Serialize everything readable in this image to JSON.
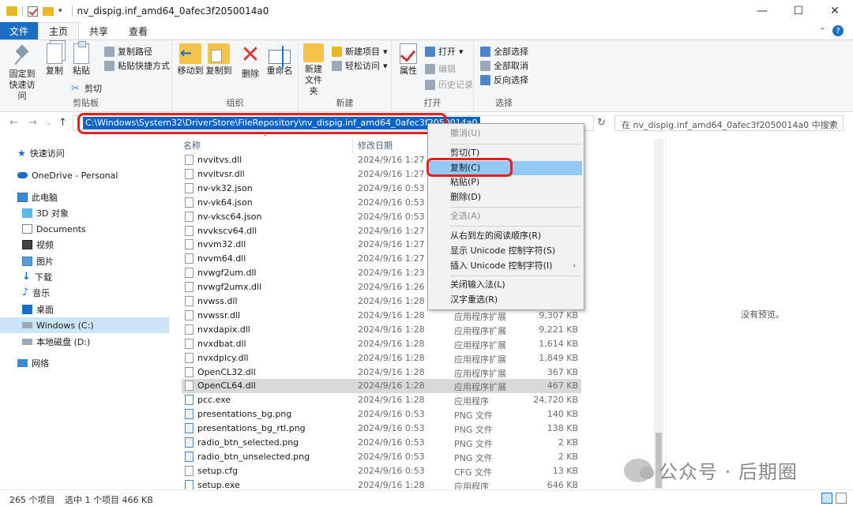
{
  "window": {
    "title": "nv_dispig.inf_amd64_0afec3f2050014a0",
    "minimize": "—",
    "maximize": "☐",
    "close": "✕"
  },
  "ribbon_tabs": [
    "文件",
    "主页",
    "共享",
    "查看"
  ],
  "ribbon": {
    "clipboard": {
      "label": "剪贴板",
      "pin": "固定到快速访问",
      "copy": "复制",
      "paste": "粘贴",
      "copy_path": "复制路径",
      "paste_shortcut": "粘贴快捷方式",
      "cut": "剪切"
    },
    "organize": {
      "label": "组织",
      "move_to": "移动到",
      "copy_to": "复制到",
      "delete": "删除",
      "rename": "重命名"
    },
    "new": {
      "label": "新建",
      "new_folder": "新建文件夹",
      "new_item": "新建项目",
      "easy_access": "轻松访问"
    },
    "open": {
      "label": "打开",
      "properties": "属性",
      "open": "打开",
      "edit": "编辑",
      "history": "历史记录"
    },
    "select": {
      "label": "选择",
      "select_all": "全部选择",
      "select_none": "全部取消",
      "invert": "反向选择"
    }
  },
  "address": {
    "path": "C:\\Windows\\System32\\DriverStore\\FileRepository\\nv_dispig.inf_amd64_0afec3f2050014a0",
    "search_placeholder": "在 nv_dispig.inf_amd64_0afec3f2050014a0 中搜索"
  },
  "sidebar": [
    {
      "label": "快速访问",
      "icon": "star-icon"
    },
    {
      "label": "OneDrive - Personal",
      "icon": "cloud-icon"
    },
    {
      "label": "此电脑",
      "icon": "computer-icon"
    },
    {
      "label": "3D 对象",
      "icon": "3d-objects-icon"
    },
    {
      "label": "Documents",
      "icon": "documents-icon"
    },
    {
      "label": "视频",
      "icon": "video-icon"
    },
    {
      "label": "图片",
      "icon": "pictures-icon"
    },
    {
      "label": "下载",
      "icon": "download-icon"
    },
    {
      "label": "音乐",
      "icon": "music-icon"
    },
    {
      "label": "桌面",
      "icon": "desktop-icon"
    },
    {
      "label": "Windows (C:)",
      "icon": "drive-icon",
      "selected": true
    },
    {
      "label": "本地磁盘 (D:)",
      "icon": "drive-icon"
    },
    {
      "label": "网络",
      "icon": "network-icon"
    }
  ],
  "columns": {
    "name": "名称",
    "date": "修改日期"
  },
  "files": [
    {
      "name": "nvvitvs.dll",
      "date": "2024/9/16 1:27",
      "type": "",
      "size": ""
    },
    {
      "name": "nvvitvsr.dll",
      "date": "2024/9/16 1:27",
      "type": "",
      "size": ""
    },
    {
      "name": "nv-vk32.json",
      "date": "2024/9/16 0:53",
      "type": "",
      "size": ""
    },
    {
      "name": "nv-vk64.json",
      "date": "2024/9/16 0:53",
      "type": "",
      "size": ""
    },
    {
      "name": "nv-vksc64.json",
      "date": "2024/9/16 0:53",
      "type": "",
      "size": ""
    },
    {
      "name": "nvvkscv64.dll",
      "date": "2024/9/16 1:27",
      "type": "",
      "size": ""
    },
    {
      "name": "nvvm32.dll",
      "date": "2024/9/16 1:27",
      "type": "",
      "size": ""
    },
    {
      "name": "nvvm64.dll",
      "date": "2024/9/16 1:27",
      "type": "",
      "size": ""
    },
    {
      "name": "nvwgf2um.dll",
      "date": "2024/9/16 1:23",
      "type": "",
      "size": ""
    },
    {
      "name": "nvwgf2umx.dll",
      "date": "2024/9/16 1:26",
      "type": "",
      "size": ""
    },
    {
      "name": "nvwss.dll",
      "date": "2024/9/16 1:28",
      "type": "",
      "size": ""
    },
    {
      "name": "nvwssr.dll",
      "date": "2024/9/16 1:28",
      "type": "应用程序扩展",
      "size": "9,307 KB"
    },
    {
      "name": "nvxdapix.dll",
      "date": "2024/9/16 1:28",
      "type": "应用程序扩展",
      "size": "9,221 KB"
    },
    {
      "name": "nvxdbat.dll",
      "date": "2024/9/16 1:28",
      "type": "应用程序扩展",
      "size": "1,614 KB"
    },
    {
      "name": "nvxdplcy.dll",
      "date": "2024/9/16 1:28",
      "type": "应用程序扩展",
      "size": "1,849 KB"
    },
    {
      "name": "OpenCL32.dll",
      "date": "2024/9/16 1:28",
      "type": "应用程序扩展",
      "size": "367 KB"
    },
    {
      "name": "OpenCL64.dll",
      "date": "2024/9/16 1:28",
      "type": "应用程序扩展",
      "size": "467 KB",
      "selected": true
    },
    {
      "name": "pcc.exe",
      "date": "2024/9/16 1:28",
      "type": "应用程序",
      "size": "24,720 KB"
    },
    {
      "name": "presentations_bg.png",
      "date": "2024/9/16 0:53",
      "type": "PNG 文件",
      "size": "140 KB"
    },
    {
      "name": "presentations_bg_rtl.png",
      "date": "2024/9/16 0:53",
      "type": "PNG 文件",
      "size": "138 KB"
    },
    {
      "name": "radio_btn_selected.png",
      "date": "2024/9/16 0:53",
      "type": "PNG 文件",
      "size": "2 KB"
    },
    {
      "name": "radio_btn_unselected.png",
      "date": "2024/9/16 0:53",
      "type": "PNG 文件",
      "size": "2 KB"
    },
    {
      "name": "setup.cfg",
      "date": "2024/9/16 0:53",
      "type": "CFG 文件",
      "size": "13 KB"
    },
    {
      "name": "setup.exe",
      "date": "2024/9/16 1:28",
      "type": "应用程序",
      "size": "646 KB"
    }
  ],
  "context_menu": {
    "undo": "撤消(U)",
    "cut": "剪切(T)",
    "copy": "复制(C)",
    "paste": "粘贴(P)",
    "delete": "删除(D)",
    "select_all": "全选(A)",
    "rtl": "从右到左的阅读顺序(R)",
    "show_unicode": "显示 Unicode 控制字符(S)",
    "insert_unicode": "插入 Unicode 控制字符(I)",
    "close_ime": "关闭输入法(L)",
    "reconvert": "汉字重选(R)"
  },
  "preview": {
    "empty": "没有预览。"
  },
  "status": {
    "count": "265 个项目",
    "selection": "选中 1 个项目  466 KB"
  },
  "watermark": {
    "text": "公众号 · 后期圈"
  },
  "colors": {
    "accent": "#1a6fc4",
    "selection": "#0b63c5",
    "highlight_ring": "#e51e1e",
    "menu_hover": "#91c9f7"
  }
}
